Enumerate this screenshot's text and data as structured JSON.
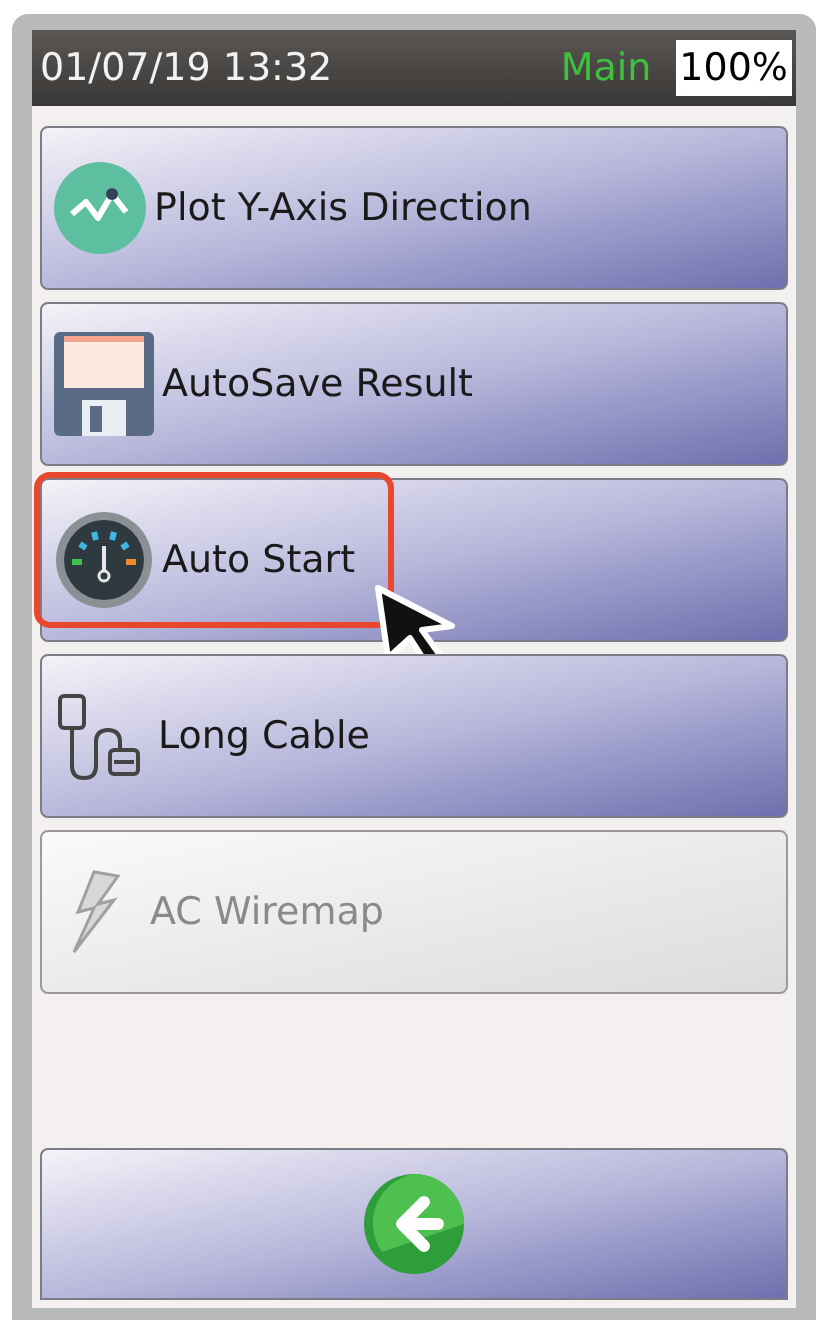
{
  "status_bar": {
    "datetime": "01/07/19 13:32",
    "mode": "Main",
    "battery": "100%"
  },
  "menu_items": [
    {
      "kind": "plot",
      "label": "Plot Y-Axis Direction",
      "disabled": false,
      "highlighted": false
    },
    {
      "kind": "save",
      "label": "AutoSave Result",
      "disabled": false,
      "highlighted": false
    },
    {
      "kind": "gauge",
      "label": "Auto Start",
      "disabled": false,
      "highlighted": true
    },
    {
      "kind": "cable",
      "label": "Long Cable",
      "disabled": false,
      "highlighted": false
    },
    {
      "kind": "lightning",
      "label": "AC Wiremap",
      "disabled": true,
      "highlighted": false
    }
  ],
  "back_button": {
    "disabled": false
  }
}
